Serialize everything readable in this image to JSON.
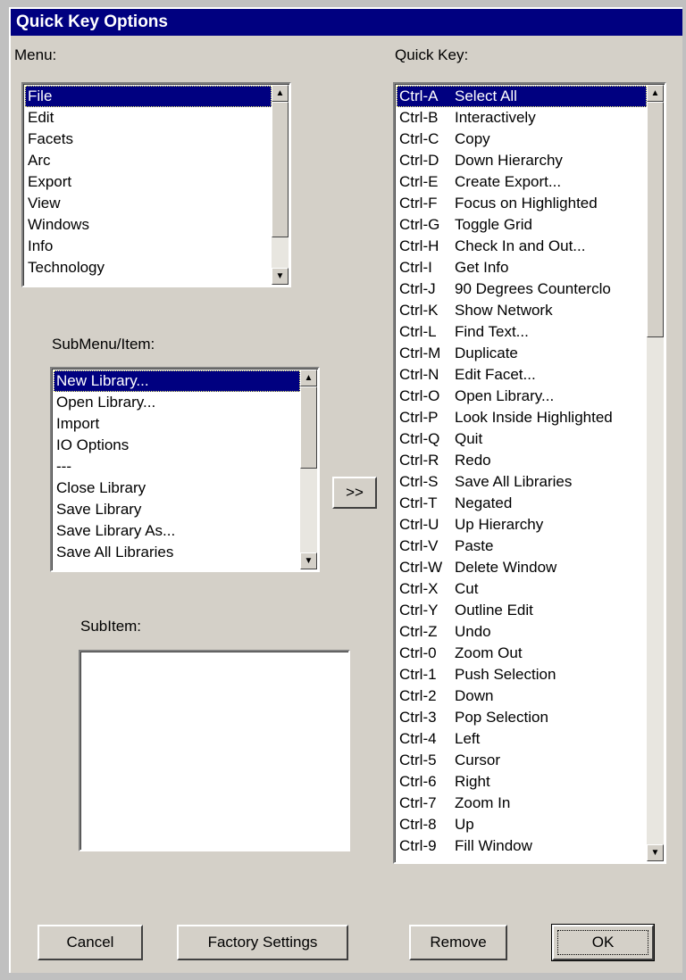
{
  "dialog": {
    "title": "Quick Key Options"
  },
  "menu": {
    "label": "Menu:",
    "items": [
      "File",
      "Edit",
      "Facets",
      "Arc",
      "Export",
      "View",
      "Windows",
      "Info",
      "Technology"
    ],
    "selected_index": 0
  },
  "submenu": {
    "label": "SubMenu/Item:",
    "items": [
      "New Library...",
      "Open Library...",
      "Import",
      "IO Options",
      "---",
      "Close Library",
      "Save Library",
      "Save Library As...",
      "Save All Libraries"
    ],
    "selected_index": 0
  },
  "subitem": {
    "label": "SubItem:",
    "items": []
  },
  "add_button": {
    "label": ">>"
  },
  "quickkey": {
    "label": "Quick Key:",
    "selected_index": 0,
    "items": [
      {
        "key": "Ctrl-A",
        "command": "Select All"
      },
      {
        "key": "Ctrl-B",
        "command": "Interactively"
      },
      {
        "key": "Ctrl-C",
        "command": "Copy"
      },
      {
        "key": "Ctrl-D",
        "command": "Down Hierarchy"
      },
      {
        "key": "Ctrl-E",
        "command": "Create Export..."
      },
      {
        "key": "Ctrl-F",
        "command": "Focus on Highlighted"
      },
      {
        "key": "Ctrl-G",
        "command": "Toggle Grid"
      },
      {
        "key": "Ctrl-H",
        "command": "Check In and Out..."
      },
      {
        "key": "Ctrl-I",
        "command": "Get Info"
      },
      {
        "key": "Ctrl-J",
        "command": "90 Degrees Counterclo"
      },
      {
        "key": "Ctrl-K",
        "command": "Show Network"
      },
      {
        "key": "Ctrl-L",
        "command": "Find Text..."
      },
      {
        "key": "Ctrl-M",
        "command": "Duplicate"
      },
      {
        "key": "Ctrl-N",
        "command": "Edit Facet..."
      },
      {
        "key": "Ctrl-O",
        "command": "Open Library..."
      },
      {
        "key": "Ctrl-P",
        "command": "Look Inside Highlighted"
      },
      {
        "key": "Ctrl-Q",
        "command": "Quit"
      },
      {
        "key": "Ctrl-R",
        "command": "Redo"
      },
      {
        "key": "Ctrl-S",
        "command": "Save All Libraries"
      },
      {
        "key": "Ctrl-T",
        "command": "Negated"
      },
      {
        "key": "Ctrl-U",
        "command": "Up Hierarchy"
      },
      {
        "key": "Ctrl-V",
        "command": "Paste"
      },
      {
        "key": "Ctrl-W",
        "command": "Delete Window"
      },
      {
        "key": "Ctrl-X",
        "command": "Cut"
      },
      {
        "key": "Ctrl-Y",
        "command": "Outline Edit"
      },
      {
        "key": "Ctrl-Z",
        "command": "Undo"
      },
      {
        "key": "Ctrl-0",
        "command": "Zoom Out"
      },
      {
        "key": "Ctrl-1",
        "command": "Push Selection"
      },
      {
        "key": "Ctrl-2",
        "command": "Down"
      },
      {
        "key": "Ctrl-3",
        "command": "Pop Selection"
      },
      {
        "key": "Ctrl-4",
        "command": "Left"
      },
      {
        "key": "Ctrl-5",
        "command": "Cursor"
      },
      {
        "key": "Ctrl-6",
        "command": "Right"
      },
      {
        "key": "Ctrl-7",
        "command": "Zoom In"
      },
      {
        "key": "Ctrl-8",
        "command": "Up"
      },
      {
        "key": "Ctrl-9",
        "command": "Fill Window"
      }
    ]
  },
  "buttons": {
    "cancel": "Cancel",
    "factory": "Factory Settings",
    "remove": "Remove",
    "ok": "OK"
  },
  "icons": {
    "scroll_up": "triangle-up-icon",
    "scroll_down": "triangle-down-icon"
  },
  "colors": {
    "titlebar": "#000080",
    "selection": "#000080",
    "face": "#d4d0c8"
  }
}
